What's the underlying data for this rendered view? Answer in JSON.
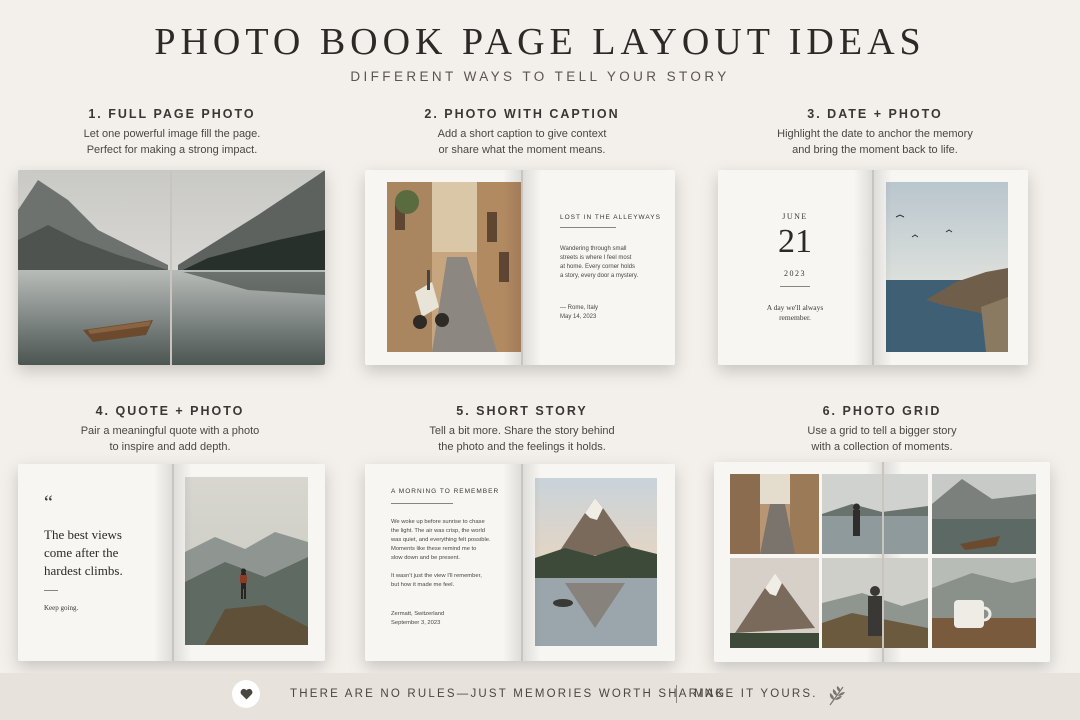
{
  "header": {
    "title": "PHOTO BOOK PAGE LAYOUT IDEAS",
    "subtitle": "DIFFERENT WAYS TO TELL YOUR STORY"
  },
  "layouts": [
    {
      "heading": "1. FULL PAGE PHOTO",
      "description": [
        "Let one powerful image fill the page.",
        "Perfect for making a strong impact."
      ]
    },
    {
      "heading": "2. PHOTO WITH CAPTION",
      "description": [
        "Add a short caption to give context",
        "or share what the moment means."
      ],
      "page": {
        "title": "LOST IN THE ALLEYWAYS",
        "body": [
          "Wandering through small",
          "streets is where I feel most",
          "at home. Every corner holds",
          "a story, every door a mystery."
        ],
        "signature": "— Rome, Italy",
        "date": "May 14, 2023"
      }
    },
    {
      "heading": "3. DATE + PHOTO",
      "description": [
        "Highlight the date to anchor the memory",
        "and bring the moment back to life."
      ],
      "page": {
        "month": "JUNE",
        "day": "21",
        "year": "2023",
        "note": [
          "A day we'll always",
          "remember."
        ]
      }
    },
    {
      "heading": "4. QUOTE + PHOTO",
      "description": [
        "Pair a meaningful quote with a photo",
        "to inspire and add depth."
      ],
      "page": {
        "quote_mark": "“",
        "quote": [
          "The best views",
          "come after the",
          "hardest climbs."
        ],
        "tagline": "Keep going."
      }
    },
    {
      "heading": "5. SHORT STORY",
      "description": [
        "Tell a bit more. Share the story behind",
        "the photo and the feelings it holds."
      ],
      "page": {
        "title": "A MORNING TO REMEMBER",
        "paragraph1": [
          "We woke up before sunrise to chase",
          "the light. The air was crisp, the world",
          "was quiet, and everything felt possible.",
          "Moments like these remind me to",
          "slow down and be present."
        ],
        "paragraph2": [
          "It wasn't just the view I'll remember,",
          "but how it made me feel."
        ],
        "location": "Zermatt, Switzerland",
        "date": "September 3, 2023"
      }
    },
    {
      "heading": "6. PHOTO GRID",
      "description": [
        "Use a grid to tell a bigger story",
        "with a collection of moments."
      ]
    }
  ],
  "footer": {
    "message": "THERE ARE NO RULES—JUST MEMORIES WORTH SHARING.",
    "cta": "MAKE IT YOURS.",
    "heart_icon": "heart-icon",
    "leaf_icon": "leaf-sprig-icon"
  },
  "colors": {
    "background": "#f3efea",
    "footer_band": "#e7e2db",
    "text_dark": "#2c2926"
  }
}
